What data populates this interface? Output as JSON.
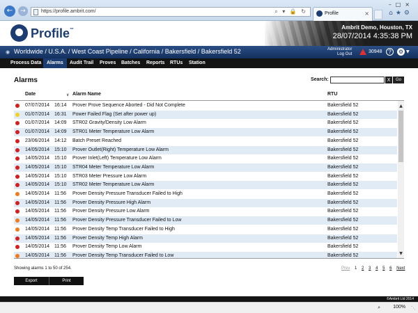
{
  "browser": {
    "url": "https://profile.ambrit.com/",
    "tab_title": "Profile"
  },
  "header": {
    "logo_text": "Profile",
    "logo_tm": "™",
    "site": "Ambrit Demo, Houston, TX",
    "datetime": "28/07/2014  4:35:38 PM"
  },
  "breadcrumb": {
    "path": "Worldwide / U.S.A. / West Coast Pipeline / California / Bakersfield / Bakersfield 52",
    "user": "Administrator",
    "logout": "Log Out",
    "alarm_count": "30948"
  },
  "menu": [
    "Process Data",
    "Alarms",
    "Audit Trail",
    "Proves",
    "Batches",
    "Reports",
    "RTUs",
    "Station"
  ],
  "page": {
    "title": "Alarms",
    "search_label": "Search:",
    "search_value": "",
    "clear_label": "X",
    "go_label": "Go"
  },
  "table": {
    "headers": {
      "date": "Date",
      "name": "Alarm Name",
      "rtu": "RTU"
    },
    "status_colors": {
      "red": "#d02020",
      "yellow": "#f0d020",
      "orange": "#f07c20"
    },
    "rows": [
      {
        "status": "red",
        "date": "07/07/2014",
        "time": "16:14",
        "name": "Prover Prove Sequence Aborted - Did Not Complete",
        "rtu": "Bakersfield 52"
      },
      {
        "status": "yellow",
        "date": "01/07/2014",
        "time": "16:31",
        "name": "Power Failed Flag (Set after power up)",
        "rtu": "Bakersfield 52"
      },
      {
        "status": "red",
        "date": "01/07/2014",
        "time": "14:09",
        "name": "STR02 Gravity/Density Low Alarm",
        "rtu": "Bakersfield 52"
      },
      {
        "status": "red",
        "date": "01/07/2014",
        "time": "14:09",
        "name": "STR01 Meter Temperature Low Alarm",
        "rtu": "Bakersfield 52"
      },
      {
        "status": "red",
        "date": "23/06/2014",
        "time": "14:12",
        "name": "Batch Preset Reached",
        "rtu": "Bakersfield 52"
      },
      {
        "status": "red",
        "date": "14/05/2014",
        "time": "15:10",
        "name": "Prover Outlet(Right) Temperature Low Alarm",
        "rtu": "Bakersfield 52"
      },
      {
        "status": "red",
        "date": "14/05/2014",
        "time": "15:10",
        "name": "Prover Inlet(Left) Temperature Low Alarm",
        "rtu": "Bakersfield 52"
      },
      {
        "status": "red",
        "date": "14/05/2014",
        "time": "15:10",
        "name": "STR04 Meter Temperature Low Alarm",
        "rtu": "Bakersfield 52"
      },
      {
        "status": "red",
        "date": "14/05/2014",
        "time": "15:10",
        "name": "STR03 Meter Pressure Low Alarm",
        "rtu": "Bakersfield 52"
      },
      {
        "status": "red",
        "date": "14/05/2014",
        "time": "15:10",
        "name": "STR02 Meter Temperature Low Alarm",
        "rtu": "Bakersfield 52"
      },
      {
        "status": "orange",
        "date": "14/05/2014",
        "time": "11:56",
        "name": "Prover Density Pressure Transducer Failed to High",
        "rtu": "Bakersfield 52"
      },
      {
        "status": "red",
        "date": "14/05/2014",
        "time": "11:56",
        "name": "Prover Density Pressure High Alarm",
        "rtu": "Bakersfield 52"
      },
      {
        "status": "red",
        "date": "14/05/2014",
        "time": "11:56",
        "name": "Prover Density Pressure Low Alarm",
        "rtu": "Bakersfield 52"
      },
      {
        "status": "orange",
        "date": "14/05/2014",
        "time": "11:56",
        "name": "Prover Density Pressure Transducer Failed to Low",
        "rtu": "Bakersfield 52"
      },
      {
        "status": "orange",
        "date": "14/05/2014",
        "time": "11:56",
        "name": "Prover Density Temp Transducer Failed to High",
        "rtu": "Bakersfield 52"
      },
      {
        "status": "red",
        "date": "14/05/2014",
        "time": "11:56",
        "name": "Prover Density Temp High Alarm",
        "rtu": "Bakersfield 52"
      },
      {
        "status": "red",
        "date": "14/05/2014",
        "time": "11:56",
        "name": "Prover Density Temp Low Alarm",
        "rtu": "Bakersfield 52"
      },
      {
        "status": "orange",
        "date": "14/05/2014",
        "time": "11:56",
        "name": "Prover Density Temp Transducer Failed to Low",
        "rtu": "Bakersfield 52"
      }
    ]
  },
  "footer": {
    "showing": "Showing alarms 1 to 50 of 254.",
    "prev": "Prev",
    "pages": [
      "1",
      "2",
      "3",
      "4",
      "5",
      "6"
    ],
    "next": "Next",
    "export_label": "Export",
    "print_label": "Print",
    "copyright": "©Ambrit Ltd 2014",
    "zoom": "100%"
  }
}
